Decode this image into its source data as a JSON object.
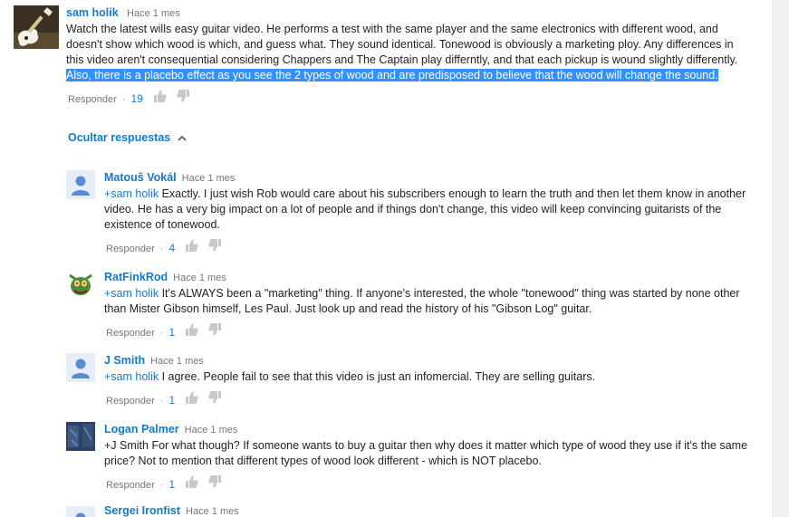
{
  "main_comment": {
    "author": "sam holik",
    "time": "Hace 1 mes",
    "text": "Watch the latest wills easy guitar video. He performs a test with the same player and the same electronics with different wood, and doesn't show which wood is which, and guess what. They sound identical. Tonewood is obviously a marketing ploy. Any differences in this video aren't consequential considering Chappers and The Captain play differntly, and that each pickup is wound slightly differently. ",
    "highlighted_text": "Also, there is a placebo effect as you see the 2 types of wood and are predisposed to believe that the wood will change the sound.",
    "reply_label": "Responder",
    "likes": "19"
  },
  "toggle_label": "Ocultar respuestas",
  "replies": [
    {
      "author": "Matouš Vokál",
      "time": "Hace 1 mes",
      "mention": "+sam holik",
      "text": " Exactly. I just wish Rob would care about his subscribers enough to learn the truth and then let them know in another video. He has a very big impact on a lot of people and if things don't change, this video will keep convincing guitarists of the existence of tonewood.",
      "reply_label": "Responder",
      "likes": "4"
    },
    {
      "author": "RatFinkRod",
      "time": "Hace 1 mes",
      "mention": "+sam holik",
      "text": " It's ALWAYS been a \"marketing\" thing.  If anyone's interested, the whole \"tonewood\" thing was started by none other than Mister Gibson himself, Les Paul.  Just look up and read the history of his \"Gibson Log\" guitar.",
      "reply_label": "Responder",
      "likes": "1"
    },
    {
      "author": "J Smith",
      "time": "Hace 1 mes",
      "mention": "+sam holik",
      "text": " I agree. People fail to see that this video is just an infomercial. They are selling guitars.",
      "reply_label": "Responder",
      "likes": "1"
    },
    {
      "author": "Logan Palmer",
      "time": "Hace 1 mes",
      "mention": "",
      "text": "+J Smith For what though? If someone wants to buy a guitar then why does it matter which type of wood they use if it's the same price? Not to mention that different types of wood look different - which is NOT placebo.",
      "reply_label": "Responder",
      "likes": "1"
    },
    {
      "author": "Sergei Ironfist",
      "time": "Hace 1 mes"
    }
  ],
  "colors": {
    "link": "#167ac6",
    "highlight": "#3390ff",
    "default_avatar": "#5a8bd6"
  },
  "icons": {
    "like": "thumb-up-icon",
    "dislike": "thumb-down-icon",
    "collapse": "chevron-up-icon"
  }
}
